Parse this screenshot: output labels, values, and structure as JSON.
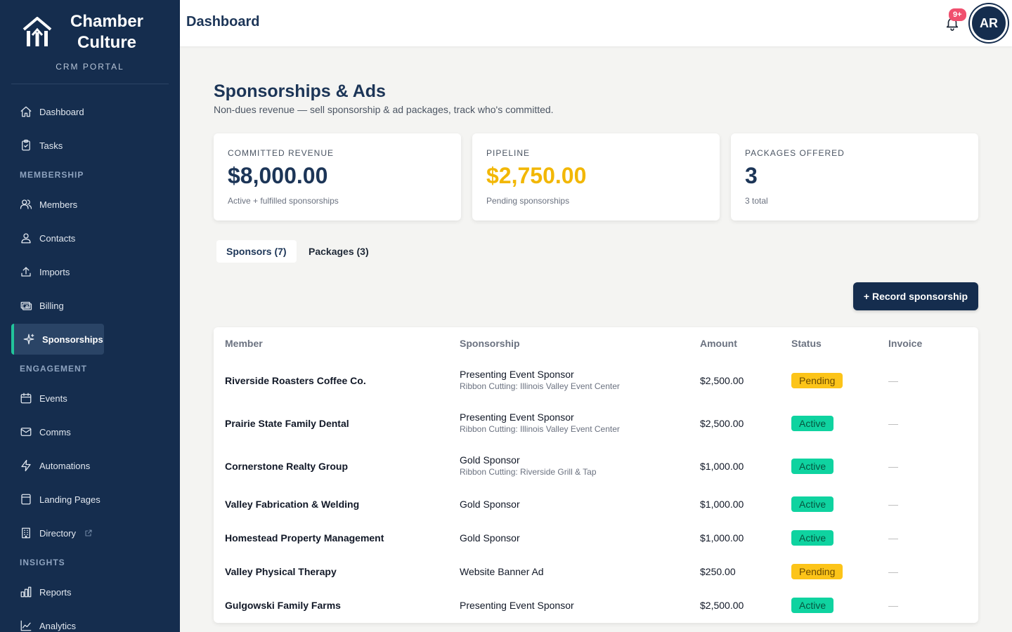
{
  "brand": {
    "name_line1": "Chamber",
    "name_line2": "Culture",
    "portal": "CRM PORTAL"
  },
  "sidebar": {
    "items": [
      {
        "label": "Dashboard",
        "icon": "home-icon"
      },
      {
        "label": "Tasks",
        "icon": "clipboard-icon"
      },
      {
        "label": "Members",
        "icon": "users-icon"
      },
      {
        "label": "Contacts",
        "icon": "user-icon"
      },
      {
        "label": "Imports",
        "icon": "upload-icon"
      },
      {
        "label": "Billing",
        "icon": "billing-icon"
      },
      {
        "label": "Sponsorships",
        "icon": "sparkle-icon"
      },
      {
        "label": "Events",
        "icon": "calendar-icon"
      },
      {
        "label": "Comms",
        "icon": "mail-icon"
      },
      {
        "label": "Automations",
        "icon": "bolt-icon"
      },
      {
        "label": "Landing Pages",
        "icon": "page-icon"
      },
      {
        "label": "Directory",
        "icon": "building-icon"
      },
      {
        "label": "Reports",
        "icon": "bar-chart-icon"
      },
      {
        "label": "Analytics",
        "icon": "line-chart-icon"
      }
    ],
    "sections": {
      "membership": "MEMBERSHIP",
      "engagement": "ENGAGEMENT",
      "insights": "INSIGHTS"
    }
  },
  "header": {
    "title": "Dashboard",
    "notification_count": "9+",
    "avatar_initials": "AR"
  },
  "page": {
    "title": "Sponsorships & Ads",
    "subtitle": "Non-dues revenue — sell sponsorship & ad packages, track who's committed."
  },
  "stats": [
    {
      "label": "COMMITTED REVENUE",
      "value": "$8,000.00",
      "note": "Active + fulfilled sponsorships"
    },
    {
      "label": "PIPELINE",
      "value": "$2,750.00",
      "note": "Pending sponsorships"
    },
    {
      "label": "PACKAGES OFFERED",
      "value": "3",
      "note": "3 total"
    }
  ],
  "tabs": [
    {
      "label": "Sponsors (7)"
    },
    {
      "label": "Packages (3)"
    }
  ],
  "record_button": "+ Record sponsorship",
  "table": {
    "headers": {
      "member": "Member",
      "sponsorship": "Sponsorship",
      "amount": "Amount",
      "status": "Status",
      "invoice": "Invoice"
    },
    "rows": [
      {
        "member": "Riverside Roasters Coffee Co.",
        "sponsorship": "Presenting Event Sponsor",
        "detail": "Ribbon Cutting: Illinois Valley Event Center",
        "amount": "$2,500.00",
        "status": "Pending",
        "invoice": "—"
      },
      {
        "member": "Prairie State Family Dental",
        "sponsorship": "Presenting Event Sponsor",
        "detail": "Ribbon Cutting: Illinois Valley Event Center",
        "amount": "$2,500.00",
        "status": "Active",
        "invoice": "—"
      },
      {
        "member": "Cornerstone Realty Group",
        "sponsorship": "Gold Sponsor",
        "detail": "Ribbon Cutting: Riverside Grill & Tap",
        "amount": "$1,000.00",
        "status": "Active",
        "invoice": "—"
      },
      {
        "member": "Valley Fabrication & Welding",
        "sponsorship": "Gold Sponsor",
        "detail": "",
        "amount": "$1,000.00",
        "status": "Active",
        "invoice": "—"
      },
      {
        "member": "Homestead Property Management",
        "sponsorship": "Gold Sponsor",
        "detail": "",
        "amount": "$1,000.00",
        "status": "Active",
        "invoice": "—"
      },
      {
        "member": "Valley Physical Therapy",
        "sponsorship": "Website Banner Ad",
        "detail": "",
        "amount": "$250.00",
        "status": "Pending",
        "invoice": "—"
      },
      {
        "member": "Gulgowski Family Farms",
        "sponsorship": "Presenting Event Sponsor",
        "detail": "",
        "amount": "$2,500.00",
        "status": "Active",
        "invoice": "—"
      }
    ]
  },
  "colors": {
    "sidebar": "#152d4e",
    "accent": "#22c49b",
    "pending": "#fcc419",
    "active": "#0fd3a0",
    "pipeline": "#f2b705"
  }
}
